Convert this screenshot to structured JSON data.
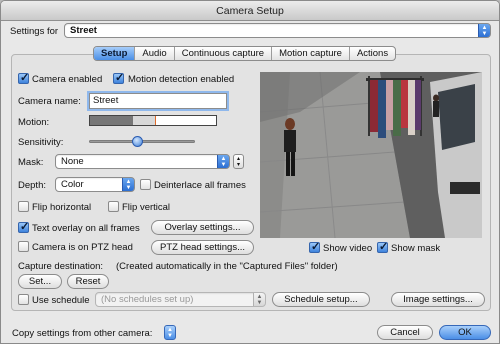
{
  "window": {
    "title": "Camera Setup"
  },
  "settings_for": {
    "label": "Settings for",
    "value": "Street"
  },
  "tabs": [
    {
      "label": "Setup",
      "selected": true
    },
    {
      "label": "Audio",
      "selected": false
    },
    {
      "label": "Continuous capture",
      "selected": false
    },
    {
      "label": "Motion capture",
      "selected": false
    },
    {
      "label": "Actions",
      "selected": false
    }
  ],
  "setup": {
    "camera_enabled": {
      "label": "Camera enabled",
      "checked": true
    },
    "motion_detection": {
      "label": "Motion detection enabled",
      "checked": true
    },
    "camera_name": {
      "label": "Camera name:",
      "value": "Street"
    },
    "motion": {
      "label": "Motion:"
    },
    "sensitivity": {
      "label": "Sensitivity:",
      "level": 0.45
    },
    "mask": {
      "label": "Mask:",
      "value": "None"
    },
    "depth": {
      "label": "Depth:",
      "value": "Color"
    },
    "deinterlace": {
      "label": "Deinterlace all frames",
      "checked": false
    },
    "flip_horizontal": {
      "label": "Flip horizontal",
      "checked": false
    },
    "flip_vertical": {
      "label": "Flip vertical",
      "checked": false
    },
    "text_overlay": {
      "label": "Text overlay on all frames",
      "checked": true
    },
    "overlay_settings_button": "Overlay settings...",
    "ptz": {
      "label": "Camera is on PTZ head",
      "checked": false
    },
    "ptz_settings_button": "PTZ head settings...",
    "capture_destination": {
      "label": "Capture destination:",
      "note": "(Created automatically in the \"Captured Files\" folder)"
    },
    "set_button": "Set...",
    "reset_button": "Reset",
    "use_schedule": {
      "label": "Use schedule",
      "checked": false
    },
    "schedule_select": "(No schedules set up)",
    "schedule_setup_button": "Schedule setup...",
    "image_settings_button": "Image settings...",
    "show_video": {
      "label": "Show video",
      "checked": true
    },
    "show_mask": {
      "label": "Show mask",
      "checked": true
    }
  },
  "footer": {
    "copy_label": "Copy settings from other camera:",
    "cancel_button": "Cancel",
    "ok_button": "OK"
  },
  "colors": {
    "accent": "#4a8fe6"
  }
}
